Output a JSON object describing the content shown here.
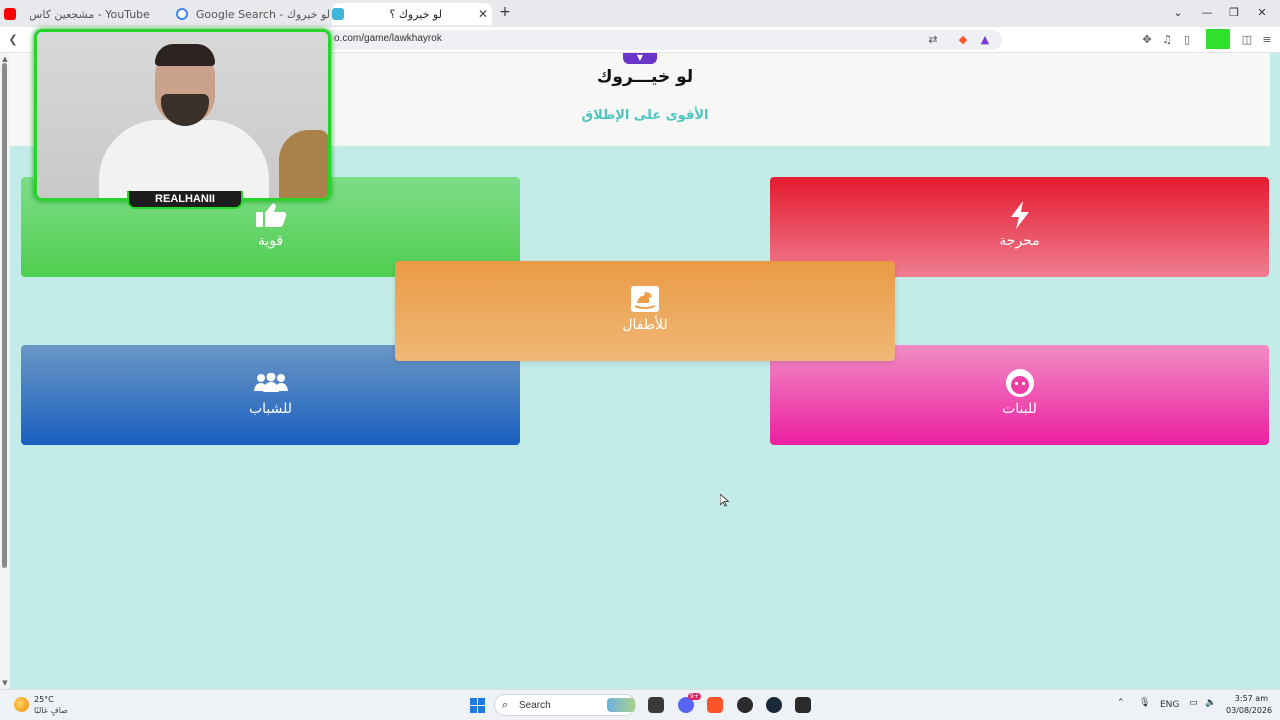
{
  "browser": {
    "tabs": [
      {
        "title": "YouTube - مشجعين كاس العالم",
        "favicon_color": "#ff0000",
        "active": false
      },
      {
        "title": "لو خيروك - Google Search",
        "favicon_color": "#4285f4",
        "active": false
      },
      {
        "title": "لو خيروك ؟",
        "favicon_color": "#3fb6d8",
        "active": true
      }
    ],
    "new_tab_symbol": "+",
    "close_symbol": "✕",
    "url": "o.com/game/lawkhayrok",
    "window_controls": [
      "⌄",
      "—",
      "❐",
      "✕"
    ]
  },
  "page": {
    "header": {
      "chip_symbol": "▼",
      "title": "لو خيـــروك",
      "subtitle": "الأقوى على الإطلاق"
    },
    "categories": [
      {
        "id": "strong",
        "label": "قوية",
        "icon": "thumbs-up-icon"
      },
      {
        "id": "embarrassing",
        "label": "محرجة",
        "icon": "lightning-icon"
      },
      {
        "id": "kids",
        "label": "للأطفال",
        "icon": "rocking-horse-icon"
      },
      {
        "id": "guys",
        "label": "للشباب",
        "icon": "users-group-icon"
      },
      {
        "id": "girls",
        "label": "للبنات",
        "icon": "girl-face-icon"
      }
    ]
  },
  "overlay": {
    "streamer_name": "REALHANII"
  },
  "taskbar": {
    "temperature": "25°C",
    "condition": "صافٍ غالبًا",
    "search_label": "Search",
    "language": "ENG",
    "time": "3:57 am",
    "date": "03/08/2026",
    "discord_badge": "9+"
  }
}
